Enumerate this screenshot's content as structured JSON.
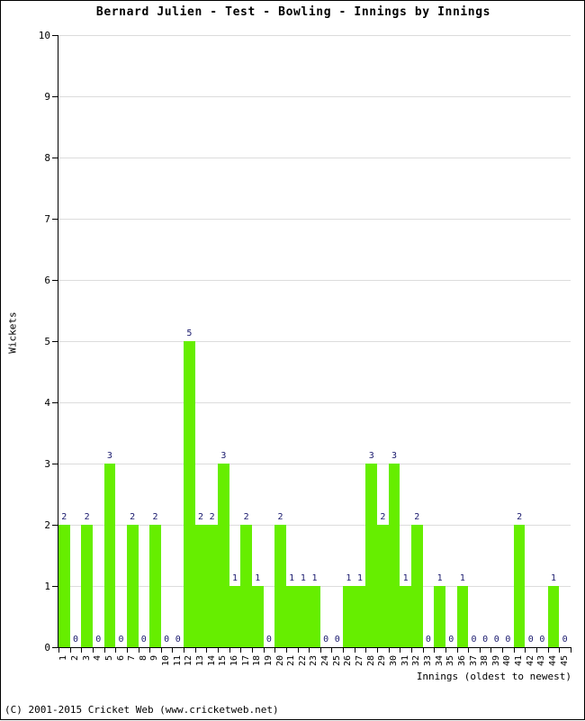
{
  "chart_data": {
    "type": "bar",
    "title": "Bernard Julien - Test - Bowling - Innings by Innings",
    "xlabel": "Innings (oldest to newest)",
    "ylabel": "Wickets",
    "ylim": [
      0,
      10
    ],
    "ytick_labels": [
      "0",
      "1",
      "2",
      "3",
      "4",
      "5",
      "6",
      "7",
      "8",
      "9",
      "10"
    ],
    "grid": true,
    "legend": null,
    "bar_color": "#66ee00",
    "label_color": "#1a1a6e",
    "categories": [
      "1",
      "2",
      "3",
      "4",
      "5",
      "6",
      "7",
      "8",
      "9",
      "10",
      "11",
      "12",
      "13",
      "14",
      "15",
      "16",
      "17",
      "18",
      "19",
      "20",
      "21",
      "22",
      "23",
      "24",
      "25",
      "26",
      "27",
      "28",
      "29",
      "30",
      "31",
      "32",
      "33",
      "34",
      "35",
      "36",
      "37",
      "38",
      "39",
      "40",
      "41",
      "42",
      "43",
      "44",
      "45"
    ],
    "values": [
      2,
      0,
      2,
      0,
      3,
      0,
      2,
      0,
      2,
      0,
      0,
      5,
      2,
      2,
      3,
      1,
      2,
      1,
      0,
      2,
      1,
      1,
      1,
      0,
      0,
      1,
      1,
      3,
      2,
      3,
      1,
      2,
      0,
      1,
      0,
      1,
      0,
      0,
      0,
      0,
      2,
      0,
      0,
      1,
      0
    ],
    "value_labels": [
      "2",
      "0",
      "2",
      "0",
      "3",
      "0",
      "2",
      "0",
      "2",
      "0",
      "0",
      "5",
      "2",
      "2",
      "3",
      "1",
      "2",
      "1",
      "0",
      "2",
      "1",
      "1",
      "1",
      "0",
      "0",
      "1",
      "1",
      "3",
      "2",
      "3",
      "1",
      "2",
      "0",
      "1",
      "0",
      "1",
      "0",
      "0",
      "0",
      "0",
      "2",
      "0",
      "0",
      "1",
      "0"
    ]
  },
  "footer": {
    "copyright": "(C) 2001-2015 Cricket Web (www.cricketweb.net)"
  }
}
